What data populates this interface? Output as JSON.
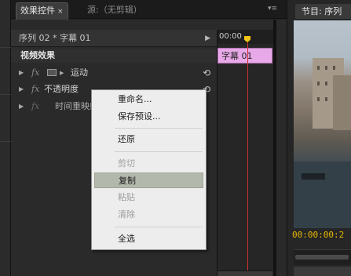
{
  "tabs": {
    "effect_controls": "效果控件",
    "close_glyph": "×",
    "source": "源:（无剪辑）",
    "menu_glyph": "▾≡"
  },
  "sequence_header": {
    "title": "序列 02 * 字幕 01",
    "arrow": "▶"
  },
  "video_effects": {
    "header": "视频效果",
    "rows": [
      {
        "fx": "fx",
        "name": "运动",
        "reset": "⟲"
      },
      {
        "fx": "fx",
        "name": "不透明度",
        "reset": "⟲"
      },
      {
        "fx": "fx",
        "name": "时间重映射",
        "reset": ""
      }
    ]
  },
  "timeline": {
    "timecode": "00:00",
    "clip_label": "字幕 01"
  },
  "context_menu": {
    "items": [
      {
        "label": "重命名...",
        "enabled": true
      },
      {
        "label": "保存预设...",
        "enabled": true
      },
      {
        "label": "还原",
        "enabled": true
      },
      {
        "label": "剪切",
        "enabled": false
      },
      {
        "label": "复制",
        "enabled": true,
        "highlighted": true
      },
      {
        "label": "粘贴",
        "enabled": false
      },
      {
        "label": "清除",
        "enabled": false
      },
      {
        "label": "全选",
        "enabled": true
      }
    ]
  },
  "program_monitor": {
    "tab": "节目: 序列",
    "timecode": "00:00:00:2"
  },
  "colors": {
    "clip": "#e8a9e8",
    "playhead": "#d03030",
    "timecode": "#e8b800",
    "menu_highlight": "#b3b8ac"
  }
}
